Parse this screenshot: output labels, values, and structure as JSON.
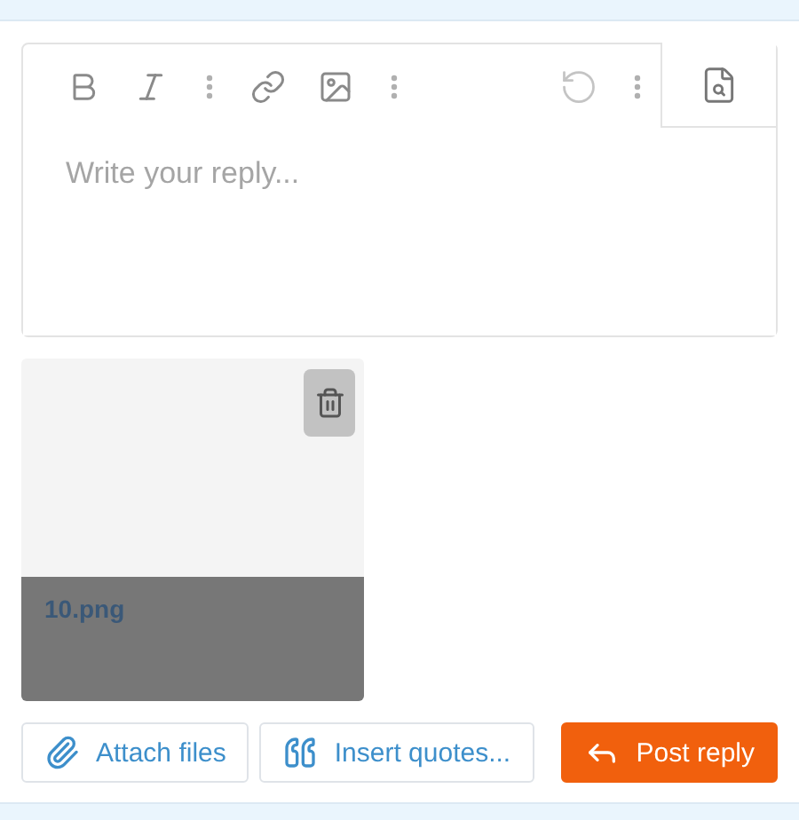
{
  "editor": {
    "toolbar": [
      {
        "kind": "bold"
      },
      {
        "kind": "italic"
      },
      {
        "kind": "more"
      },
      {
        "kind": "link"
      },
      {
        "kind": "image"
      },
      {
        "kind": "more"
      },
      {
        "kind": "spacer"
      },
      {
        "kind": "undo"
      },
      {
        "kind": "more"
      }
    ],
    "placeholder": "Write your reply..."
  },
  "attachments": [
    {
      "name": "10.png"
    }
  ],
  "buttons": [
    {
      "kind": "attach",
      "label": "Attach files"
    },
    {
      "kind": "quote",
      "label": "Insert quotes..."
    },
    {
      "kind": "post",
      "label": "Post reply"
    }
  ]
}
